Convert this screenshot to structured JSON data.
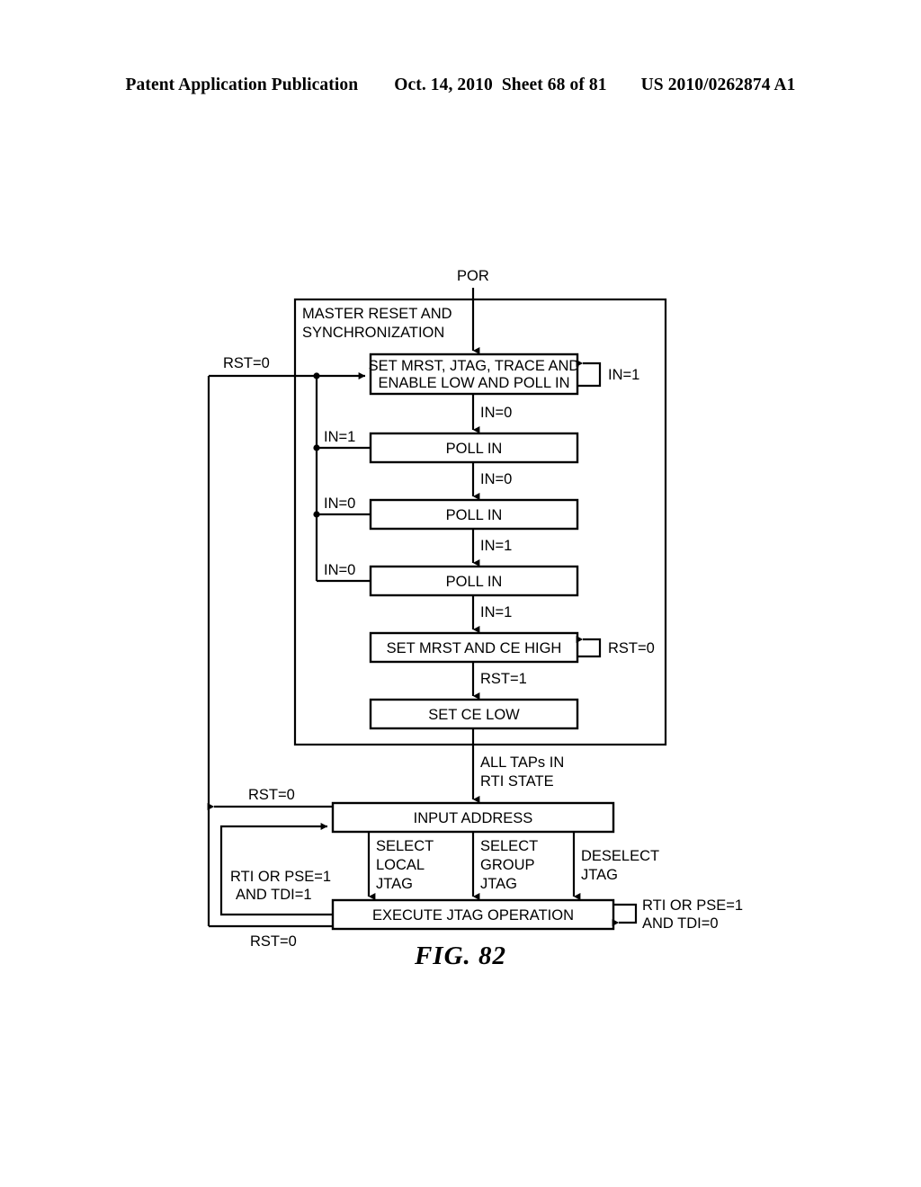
{
  "header": {
    "publication": "Patent Application Publication",
    "date": "Oct. 14, 2010",
    "sheet": "Sheet 68 of 81",
    "patent_number": "US 2010/0262874 A1"
  },
  "figure": {
    "caption": "FIG. 82",
    "container_label_line1": "MASTER RESET AND",
    "container_label_line2": "SYNCHRONIZATION"
  },
  "nodes": {
    "por": "POR",
    "set_mrst_line1": "SET MRST, JTAG, TRACE AND",
    "set_mrst_line2": "ENABLE LOW AND POLL IN",
    "poll_in_1": "POLL IN",
    "poll_in_2": "POLL IN",
    "poll_in_3": "POLL IN",
    "set_mrst_ce_high": "SET MRST AND CE HIGH",
    "set_ce_low": "SET CE LOW",
    "input_address": "INPUT ADDRESS",
    "execute_jtag": "EXECUTE JTAG OPERATION"
  },
  "edge_labels": {
    "rst_eq_0_left": "RST=0",
    "in_eq_1_selfloop_top": "IN=1",
    "in_eq_0_down_1": "IN=0",
    "in_eq_1_back_1": "IN=1",
    "in_eq_0_down_2": "IN=0",
    "in_eq_0_back_2": "IN=0",
    "in_eq_1_down_3": "IN=1",
    "in_eq_0_back_3": "IN=0",
    "in_eq_1_down_4": "IN=1",
    "rst_eq_0_selfloop": "RST=0",
    "rst_eq_1_down": "RST=1",
    "all_taps_line1": "ALL TAPs IN",
    "all_taps_line2": "RTI STATE",
    "rst_eq_0_input_address": "RST=0",
    "select_local_l1": "SELECT",
    "select_local_l2": "LOCAL",
    "select_local_l3": "JTAG",
    "select_group_l1": "SELECT",
    "select_group_l2": "GROUP",
    "select_group_l3": "JTAG",
    "deselect_l1": "DESELECT",
    "deselect_l2": "JTAG",
    "rti_pse_back_l1": "RTI OR PSE=1",
    "rti_pse_back_l2": "AND TDI=1",
    "rti_pse_selfloop_l1": "RTI OR PSE=1",
    "rti_pse_selfloop_l2": "AND TDI=0",
    "rst_eq_0_bottom": "RST=0"
  }
}
